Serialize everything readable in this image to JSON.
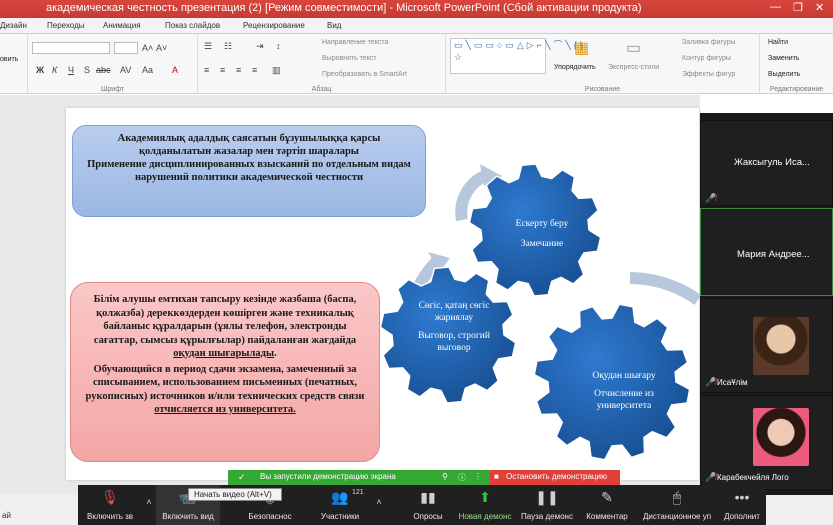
{
  "window": {
    "title": "академическая честность презентация (2) [Режим совместимости] - Microsoft PowerPoint (Сбой активации продукта)",
    "controls": [
      "—",
      "❐",
      "✕"
    ]
  },
  "tabs": [
    "Дизайн",
    "Переходы",
    "Анимация",
    "Показ слайдов",
    "Рецензирование",
    "Вид"
  ],
  "ribbon": {
    "left_cut": "овить",
    "groups": {
      "font": "Шрифт",
      "paragraph": "Абзац",
      "drawing": "Рисование",
      "editing": "Редактирование"
    },
    "paragraph_items": [
      "Направление текста",
      "Выровнять текст",
      "Преобразовать в SmartArt"
    ],
    "drawing_items": [
      "Упорядочить",
      "Экспресс-стили",
      "Заливка фигуры",
      "Контур фигуры",
      "Эффекты фигур"
    ],
    "editing_items": [
      "Найти",
      "Заменить",
      "Выделить"
    ],
    "font_controls": [
      "Ж",
      "К",
      "Ч",
      "S",
      "abc",
      "AV",
      "Aa",
      "A",
      "A˄",
      "A˅"
    ]
  },
  "slide": {
    "box_top": {
      "kk": "Академиялық адалдық саясатын бұзушылыққа қарсы қолданылатын жазалар мен тәртіп шаралары",
      "ru": "Применение дисциплинированных взысканий по отдельным видам нарушений политики академической честности"
    },
    "box_bottom": {
      "kk_part1": "Білім алушы емтихан тапсыру кезінде жазбаша (баспа, қолжазба) дереккөздерден көшірген және техникалық байланыс құралдарын (ұялы телефон, электронды сағаттар, сымсыз құрылғылар) пайдаланған жағдайда ",
      "kk_underlined": "оқудан шығарылады",
      "kk_end": ".",
      "ru_part1": "Обучающийся в период сдачи экзамена, замеченный за списыванием, использованием письменных (печатных, рукописных) источников и/или технических средств связи ",
      "ru_underlined": "отчисляется из университета."
    },
    "gears": [
      {
        "kk": "Ескерту беру",
        "ru": "Замечание"
      },
      {
        "kk": "Сөгіс, қатаң сөгіс жариялау",
        "ru": "Выговор, строгий выговор"
      },
      {
        "kk": "Оқудан шығару",
        "ru": "Отчисление из университета"
      }
    ]
  },
  "participants": [
    {
      "name": "Жаксыгуль  Иса...",
      "muted": true,
      "has_video": false,
      "active": false
    },
    {
      "name": "Мария  Андрее...",
      "muted": false,
      "has_video": false,
      "active": true
    },
    {
      "name": "ИсаҰлім",
      "muted": true,
      "has_video": true,
      "active": false
    },
    {
      "name": "Карабекчейля Лого",
      "muted": true,
      "has_video": true,
      "active": false
    }
  ],
  "share_banner": {
    "message": "Вы запустили демонстрацию экрана",
    "stop_label": "Остановить демонстрацию"
  },
  "tooltip": "Начать видео (Alt+V)",
  "toolbar": {
    "items": [
      {
        "label": "Включить зв",
        "icon": "microphone-muted-icon"
      },
      {
        "label": "Включить вид",
        "icon": "video-off-icon"
      },
      {
        "label": "Безопаснос",
        "icon": "shield-icon"
      },
      {
        "label": "Участники",
        "icon": "participants-icon",
        "count": "121"
      },
      {
        "label": "Опросы",
        "icon": "polls-icon"
      },
      {
        "label": "Новая демонс",
        "icon": "share-screen-icon"
      },
      {
        "label": "Пауза демонс",
        "icon": "pause-icon"
      },
      {
        "label": "Комментар",
        "icon": "annotate-icon"
      },
      {
        "label": "Дистанционное уп",
        "icon": "remote-control-icon"
      },
      {
        "label": "Дополнит",
        "icon": "more-icon"
      }
    ]
  },
  "bottom_left": "ай",
  "colors": {
    "title_bar": "#c73a32",
    "gear_blue": "#1f5fa8",
    "gear_arrow": "#b8c8dc",
    "banner_green": "#35a835",
    "stop_red": "#e0403a"
  }
}
